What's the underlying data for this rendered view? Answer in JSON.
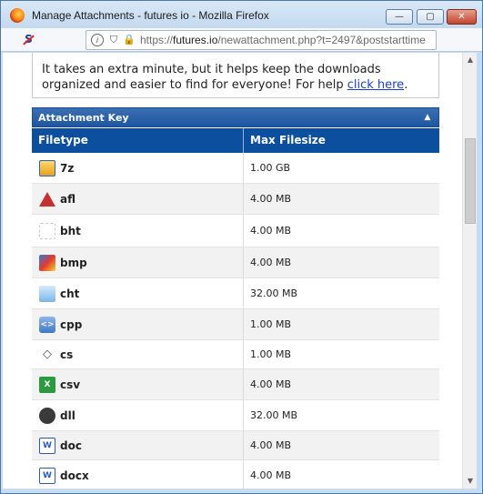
{
  "window": {
    "title": "Manage Attachments - futures io - Mozilla Firefox",
    "min_glyph": "—",
    "max_glyph": "▢",
    "close_glyph": "✕"
  },
  "address": {
    "url_prefix": "https://",
    "url_host": "futures.io",
    "url_path": "/newattachment.php?t=2497&poststarttime"
  },
  "notice": {
    "text": "It takes an extra minute, but it helps keep the downloads organized and easier to find for everyone! For help ",
    "link_text": "click here",
    "suffix": "."
  },
  "attachment_key": {
    "title": "Attachment Key",
    "columns": {
      "filetype": "Filetype",
      "max_filesize": "Max Filesize"
    },
    "rows": [
      {
        "ext": "7z",
        "size": "1.00 GB",
        "icon": "archive"
      },
      {
        "ext": "afl",
        "size": "4.00 MB",
        "icon": "afl"
      },
      {
        "ext": "bht",
        "size": "4.00 MB",
        "icon": "bht"
      },
      {
        "ext": "bmp",
        "size": "4.00 MB",
        "icon": "bmp"
      },
      {
        "ext": "cht",
        "size": "32.00 MB",
        "icon": "cht"
      },
      {
        "ext": "cpp",
        "size": "1.00 MB",
        "icon": "cpp"
      },
      {
        "ext": "cs",
        "size": "1.00 MB",
        "icon": "cs"
      },
      {
        "ext": "csv",
        "size": "4.00 MB",
        "icon": "csv"
      },
      {
        "ext": "dll",
        "size": "32.00 MB",
        "icon": "dll"
      },
      {
        "ext": "doc",
        "size": "4.00 MB",
        "icon": "doc"
      },
      {
        "ext": "docx",
        "size": "4.00 MB",
        "icon": "doc"
      }
    ]
  },
  "colors": {
    "key_header": "#1f56a0",
    "column_header": "#0b4f9e",
    "link": "#1a3fcf"
  }
}
